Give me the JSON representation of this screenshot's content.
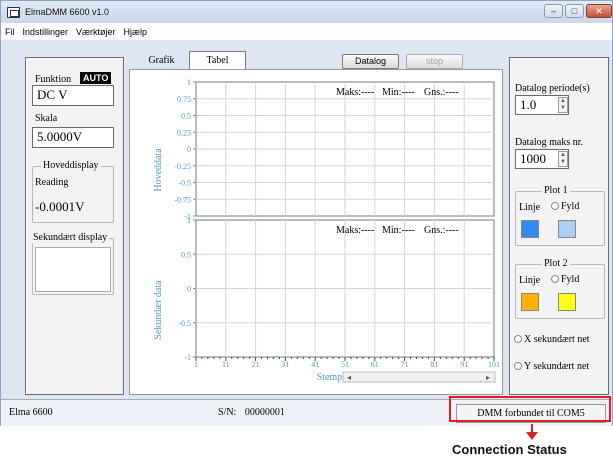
{
  "window": {
    "title": "ElmaDMM 6600 v1.0"
  },
  "menu": [
    "Fil",
    "Indstillinger",
    "Værktøjer",
    "Hjælp"
  ],
  "left": {
    "funktion_label": "Funktion",
    "auto_badge": "AUTO",
    "funktion_value": "DC V",
    "skala_label": "Skala",
    "skala_value": "5.0000V",
    "hoveddisplay_title": "Hoveddisplay",
    "reading_label": "Reading",
    "reading_value": "-0.0001V",
    "sekundaert_title": "Sekundært display"
  },
  "tabs": {
    "grafik": "Grafik",
    "tabel": "Tabel"
  },
  "toolbar": {
    "datalog": "Datalog",
    "stop": "stop"
  },
  "charts": {
    "top": {
      "ylabel": "Hoveddata",
      "yticks": [
        "1",
        "0.75",
        "0.5",
        "0.25",
        "0",
        "-0.25",
        "-0.5",
        "-0.75",
        "-1"
      ],
      "stats": [
        "Maks:----",
        "Min:----",
        "Gns.:----"
      ]
    },
    "bottom": {
      "ylabel": "Sekundær data",
      "yticks": [
        "1",
        "0.5",
        "0",
        "-0.5",
        "-1"
      ],
      "stats": [
        "Maks:----",
        "Min:----",
        "Gns.:----"
      ],
      "xticks": [
        "1",
        "11",
        "21",
        "31",
        "41",
        "51",
        "61",
        "71",
        "81",
        "91",
        "101"
      ],
      "xlabel": "Stempel"
    }
  },
  "right": {
    "periode_label": "Datalog periode(s)",
    "periode_value": "1.0",
    "maks_label": "Datalog maks nr.",
    "maks_value": "1000",
    "plot1": {
      "title": "Plot 1",
      "linje": "Linje",
      "fyld": "Fyld",
      "color_linje": "#2f8df2",
      "color_fyld": "#a9cff2"
    },
    "plot2": {
      "title": "Plot 2",
      "linje": "Linje",
      "fyld": "Fyld",
      "color_linje": "#ffb300",
      "color_fyld": "#ffff1a"
    },
    "x_sek": "X sekundært net",
    "y_sek": "Y sekundært net"
  },
  "status": {
    "device": "Elma 6600",
    "serial_label": "S/N:",
    "serial_value": "00000001",
    "connection": "DMM forbundet til COM5"
  },
  "annotation": {
    "label": "Connection Status"
  },
  "colors": {
    "tick_color": "#4a9ac9",
    "annotation": "#e02020"
  }
}
